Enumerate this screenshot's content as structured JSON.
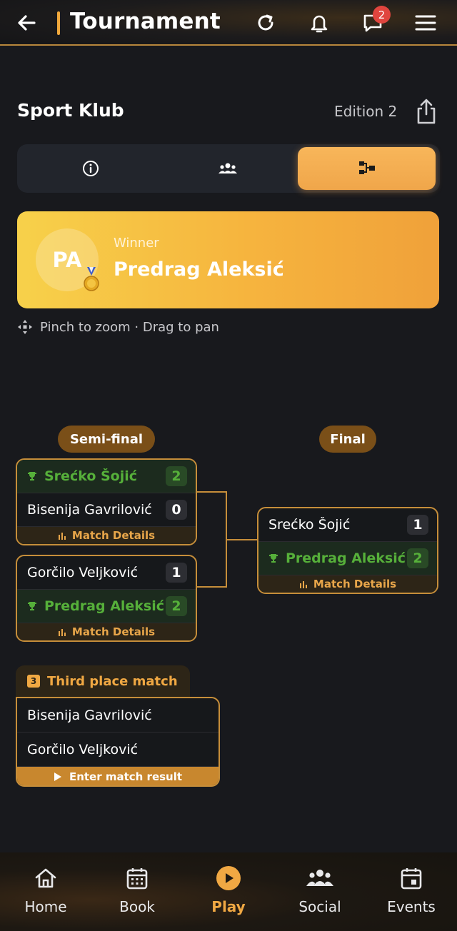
{
  "header": {
    "title": "Tournament",
    "chat_badge": "2",
    "icons": [
      "back-arrow-icon",
      "refresh-icon",
      "bell-icon",
      "chat-icon",
      "menu-icon"
    ]
  },
  "club": {
    "name": "Sport Klub",
    "edition": "Edition 2"
  },
  "tabs": [
    {
      "icon": "info-icon",
      "active": false
    },
    {
      "icon": "players-icon",
      "active": false
    },
    {
      "icon": "bracket-icon",
      "active": true
    }
  ],
  "winner": {
    "initials": "PA",
    "label": "Winner",
    "name": "Predrag Aleksić"
  },
  "hint": "Pinch to zoom · Drag to pan",
  "bracket": {
    "rounds": [
      "Semi-final",
      "Final"
    ],
    "semis": [
      {
        "players": [
          {
            "name": "Srećko Šojić",
            "score": "2",
            "winner": true
          },
          {
            "name": "Bisenija Gavrilović",
            "score": "0",
            "winner": false
          }
        ],
        "details_label": "Match Details"
      },
      {
        "players": [
          {
            "name": "Gorčilo Veljković",
            "score": "1",
            "winner": false
          },
          {
            "name": "Predrag Aleksić",
            "score": "2",
            "winner": true
          }
        ],
        "details_label": "Match Details"
      }
    ],
    "final": {
      "players": [
        {
          "name": "Srećko Šojić",
          "score": "1",
          "winner": false
        },
        {
          "name": "Predrag Aleksić",
          "score": "2",
          "winner": true
        }
      ],
      "details_label": "Match Details"
    },
    "third_place": {
      "number": "3",
      "title": "Third place match",
      "players": [
        "Bisenija Gavrilović",
        "Gorčilo Veljković"
      ],
      "action_label": "Enter match result"
    }
  },
  "bottom_nav": [
    {
      "label": "Home",
      "icon": "home-icon"
    },
    {
      "label": "Book",
      "icon": "calendar-grid-icon"
    },
    {
      "label": "Play",
      "icon": "play-icon",
      "active": true
    },
    {
      "label": "Social",
      "icon": "social-icon"
    },
    {
      "label": "Events",
      "icon": "event-icon"
    }
  ],
  "colors": {
    "accent": "#f0a843",
    "winner_green": "#56b03a",
    "background": "#18191d",
    "badge_red": "#e0453e"
  }
}
